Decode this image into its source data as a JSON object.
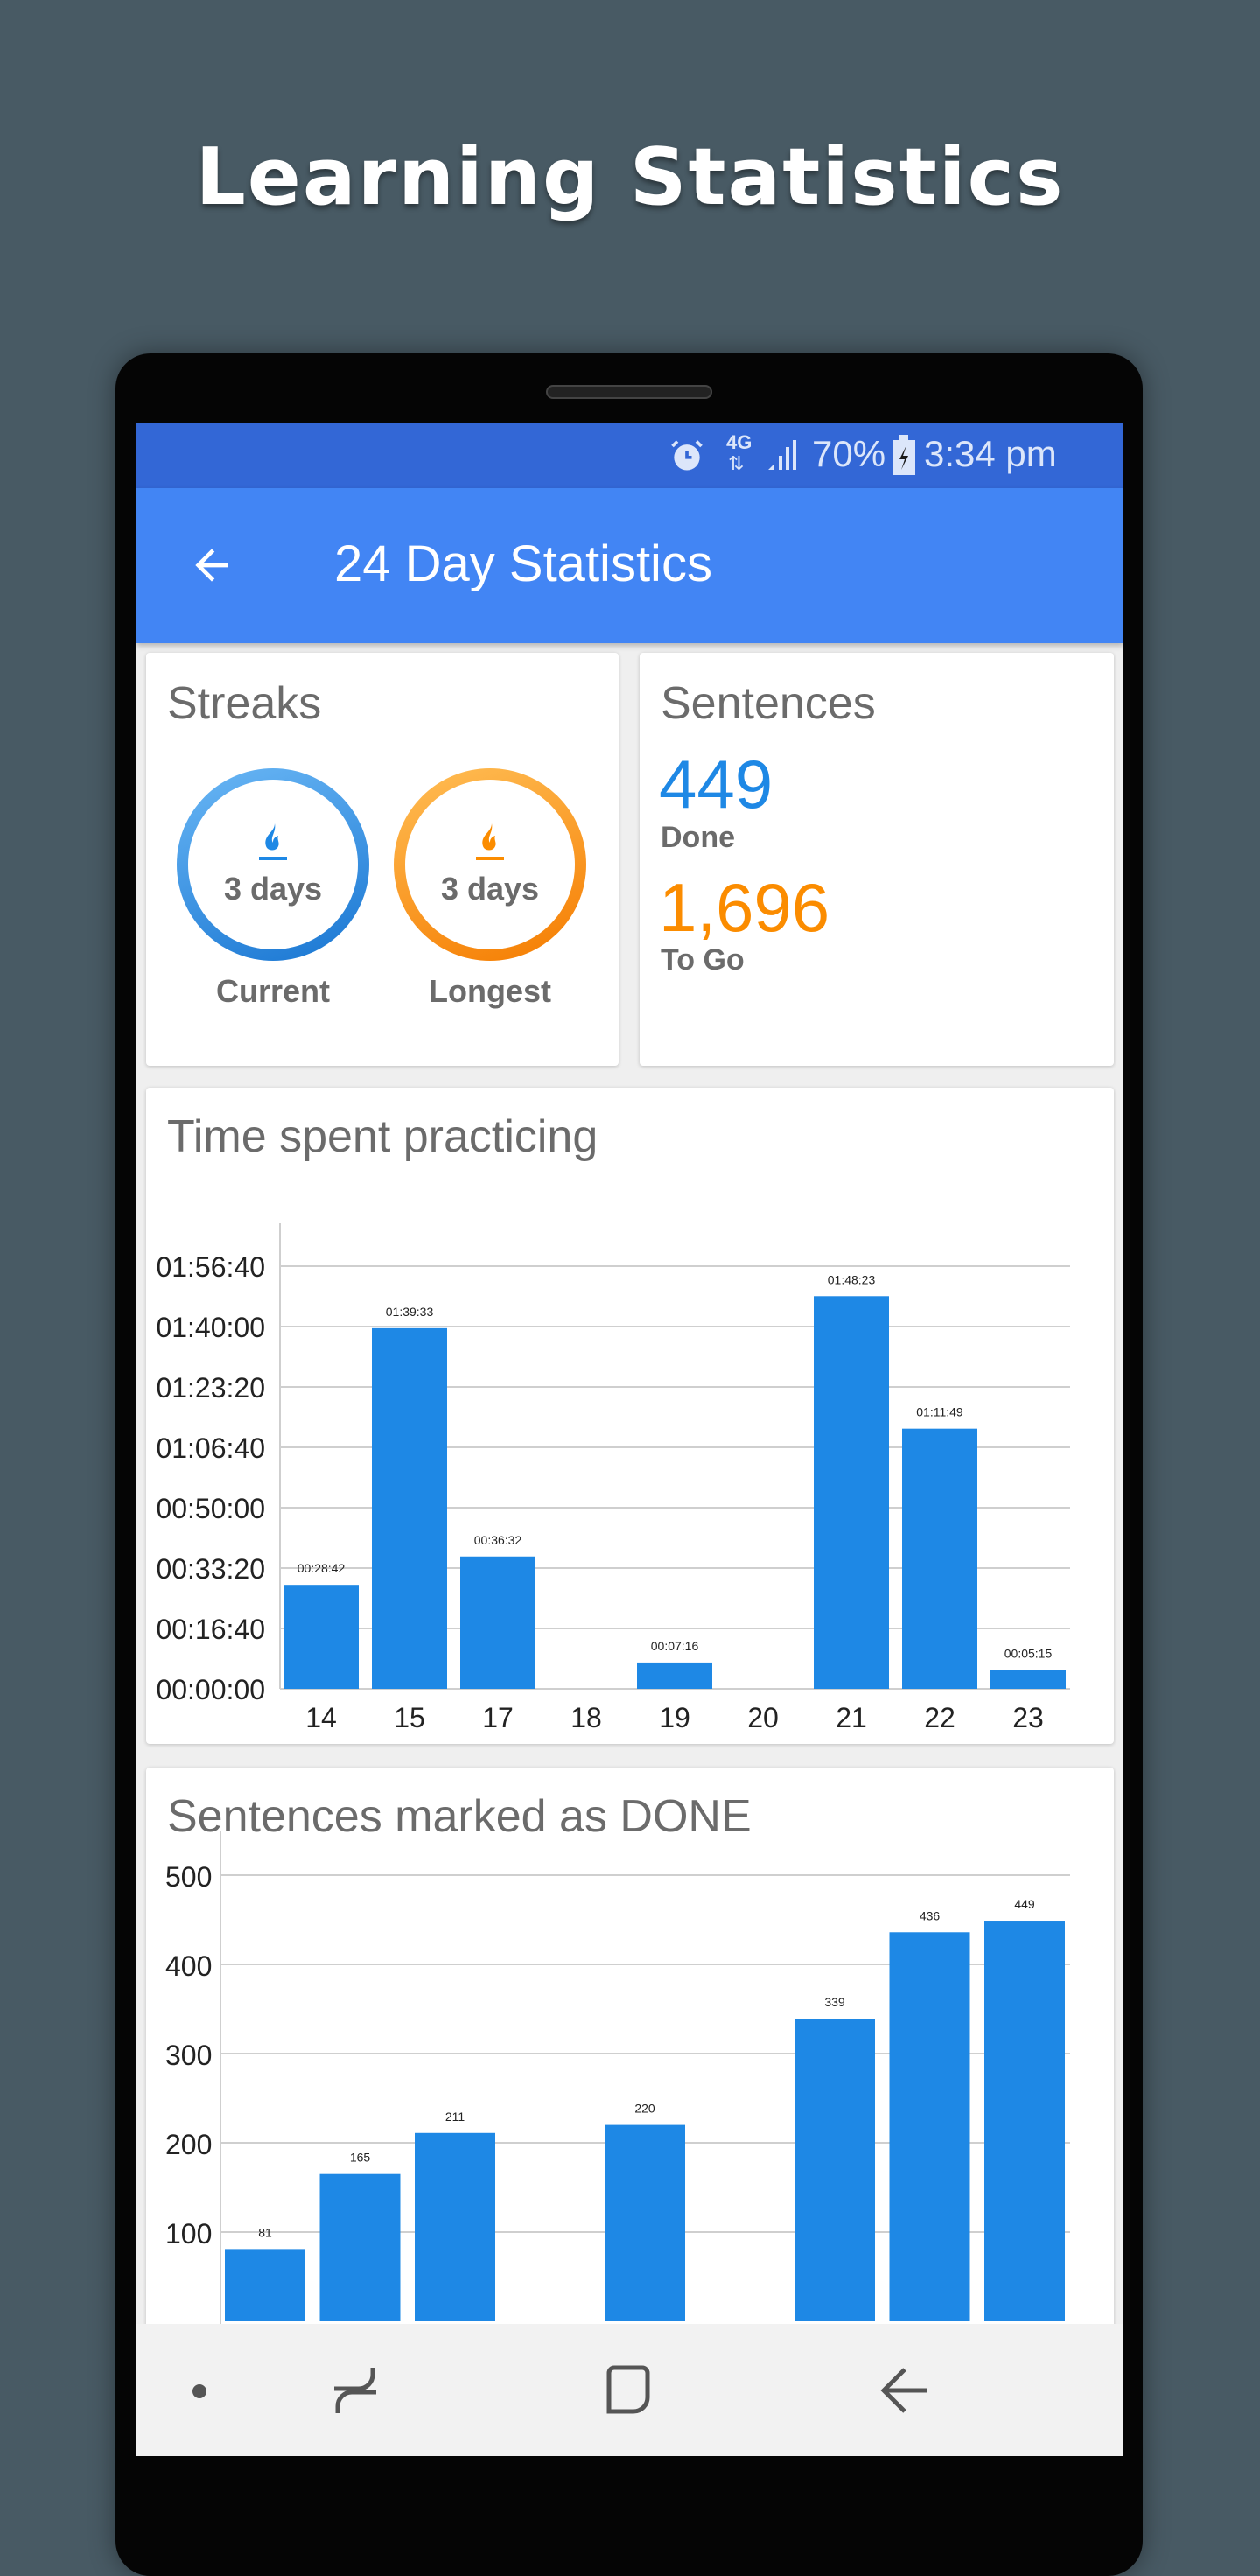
{
  "headline": "Learning Statistics",
  "status_bar": {
    "network": "4G",
    "battery": "70%",
    "time": "3:34 pm",
    "icons": [
      "alarm-icon",
      "data-arrows-icon",
      "signal-icon",
      "battery-charging-icon"
    ]
  },
  "app_bar": {
    "title": "24 Day Statistics",
    "back_icon": "arrow-left-icon"
  },
  "streaks": {
    "title": "Streaks",
    "current": {
      "value": "3 days",
      "label": "Current"
    },
    "longest": {
      "value": "3 days",
      "label": "Longest"
    },
    "colors": {
      "current": "#1e88e5",
      "longest": "#fb8c00"
    }
  },
  "sentences": {
    "title": "Sentences",
    "done": {
      "value": "449",
      "label": "Done"
    },
    "to_go": {
      "value": "1,696",
      "label": "To Go"
    },
    "colors": {
      "done": "#1e88e5",
      "to_go": "#fb8c00"
    }
  },
  "time_card": {
    "title": "Time spent practicing"
  },
  "done_card": {
    "title": "Sentences marked as DONE"
  },
  "chart_data": [
    {
      "type": "bar",
      "title": "Time spent practicing",
      "categories": [
        "14",
        "15",
        "17",
        "18",
        "19",
        "20",
        "21",
        "22",
        "23"
      ],
      "values": [
        "00:28:42",
        "01:39:33",
        "00:36:32",
        "00:00:00",
        "00:07:16",
        "00:00:00",
        "01:48:23",
        "01:11:49",
        "00:05:15"
      ],
      "data_labels": [
        "00:28:42",
        "01:39:33",
        "00:36:32",
        "",
        "00:07:16",
        "",
        "01:48:23",
        "01:11:49",
        "00:05:15"
      ],
      "yticks": [
        "00:00:00",
        "00:16:40",
        "00:33:20",
        "00:50:00",
        "01:06:40",
        "01:23:20",
        "01:40:00",
        "01:56:40"
      ],
      "ylim": [
        "00:00:00",
        "01:56:40"
      ],
      "grid": true,
      "color": "#1e88e5"
    },
    {
      "type": "bar",
      "title": "Sentences marked as DONE",
      "values": [
        81,
        165,
        211,
        null,
        220,
        null,
        339,
        436,
        449
      ],
      "yticks": [
        "100",
        "200",
        "300",
        "400",
        "500"
      ],
      "ylim": [
        0,
        500
      ],
      "grid": true,
      "color": "#1e88e5"
    }
  ],
  "nav_bar": {
    "icons": [
      "dot-icon",
      "recents-icon",
      "home-icon",
      "back-icon"
    ]
  }
}
